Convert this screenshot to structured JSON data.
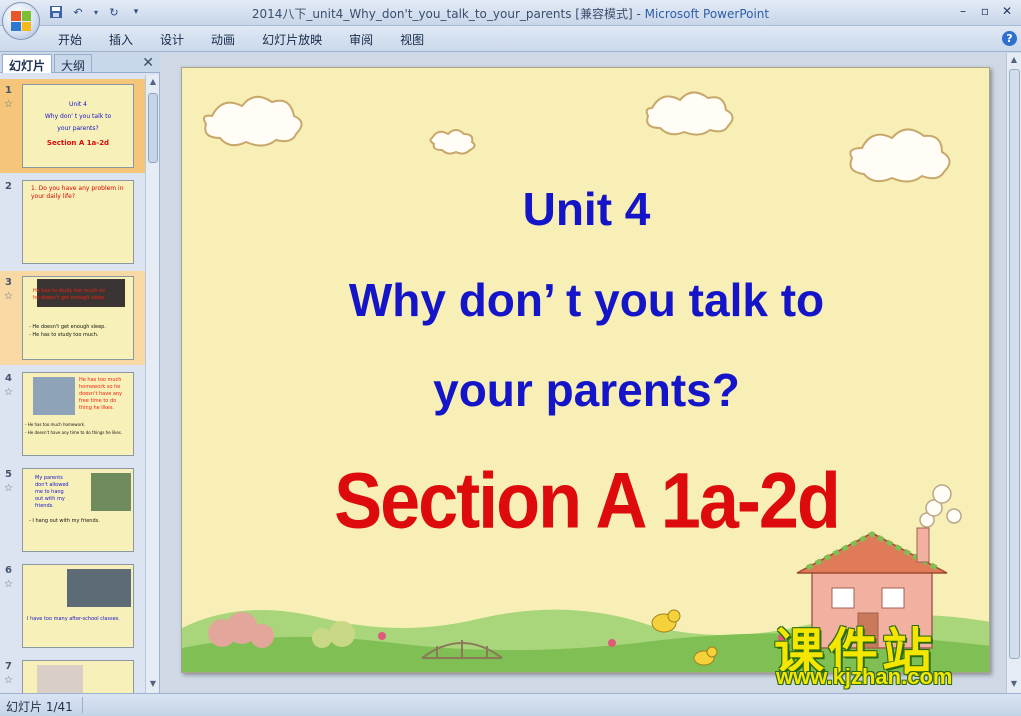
{
  "window": {
    "title_doc": "2014八下_unit4_Why_don't_you_talk_to_your_parents [兼容模式]",
    "title_sep": " - ",
    "title_app": "Microsoft PowerPoint"
  },
  "ribbon": {
    "tabs": [
      "开始",
      "插入",
      "设计",
      "动画",
      "幻灯片放映",
      "审阅",
      "视图"
    ]
  },
  "leftpane": {
    "tab_slides": "幻灯片",
    "tab_outline": "大纲"
  },
  "thumbnails": [
    {
      "num": "1",
      "lines": [
        "Unit 4",
        "Why don' t you talk to",
        "your parents?",
        "Section A 1a-2d"
      ]
    },
    {
      "num": "2",
      "lines": [
        "1. Do you have any problem in",
        "your daily life?"
      ]
    },
    {
      "num": "3",
      "lines": [
        "He has to study too much so",
        "he doesn't get enough sleep.",
        "- He doesn't get enough sleep.",
        "- He has to study too much."
      ]
    },
    {
      "num": "4",
      "lines": [
        "He has too much",
        "homework so he",
        "doesn't have any",
        "free time to do",
        "thing he likes.",
        "- He has too much homework.",
        "- He doesn't have any time to do things he likes."
      ]
    },
    {
      "num": "5",
      "lines": [
        "My parents",
        "don't allowed",
        "me to hang",
        "out with my",
        "friends.",
        "- I hang out with my friends."
      ]
    },
    {
      "num": "6",
      "lines": [
        "I have too many after-school classes."
      ]
    },
    {
      "num": "7",
      "lines": []
    }
  ],
  "slide": {
    "title_line1": "Unit 4",
    "title_line2": "Why don’ t you talk to",
    "title_line3": "your parents?",
    "section": "Section A 1a-2d"
  },
  "watermark": {
    "brand": "课件站",
    "url": "www.kjzhan.com"
  },
  "status": {
    "slide_counter": "幻灯片 1/41"
  }
}
